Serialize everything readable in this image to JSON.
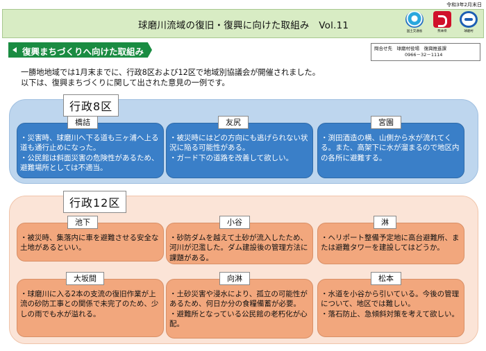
{
  "date": "令和3年2月末日",
  "header": {
    "title": "球磨川流域の復旧・復興に向けた取組み　Vol.11",
    "logos": [
      {
        "icon": "mlit-logo-icon",
        "caption": "国土交通省"
      },
      {
        "icon": "kumamoto-logo-icon",
        "caption": "熊本県"
      },
      {
        "icon": "kuma-village-logo-icon",
        "caption": "球磨村"
      }
    ]
  },
  "section": {
    "banner": "復興まちづくりへ向けた取組み",
    "contact_line1": "問合せ先　球磨村役場　復興推進課",
    "contact_line2": "0966－32－1114"
  },
  "intro": {
    "line1": "一勝地地域では1月末までに、行政8区および12区で地域別協議会が開催されました。",
    "line2": "以下は、復興まちづくりに関して出された意見の一例です。"
  },
  "groups": [
    {
      "label": "行政8区",
      "color": "#3a7fc8",
      "areas": [
        {
          "name": "橋詰",
          "text": "・災害時、球磨川へ下る道も三ヶ浦へ上る道も通行止めになった。\n・公民館は斜面災害の危険性があるため、避難場所としては不適当。"
        },
        {
          "name": "友尻",
          "text": "・被災時にはどの方向にも逃げられない状況に陥る可能性がある。\n・ガード下の道路を改善して欲しい。"
        },
        {
          "name": "宮園",
          "text": "・渕田酒造の横、山側から水が流れてくる。また、高架下に水が溜まるので地区内の各所に避難する。"
        }
      ]
    },
    {
      "label": "行政12区",
      "color": "#f2a77d",
      "areas": [
        {
          "name": "池下",
          "text": "・被災時、集落内に車を避難させる安全な土地があるといい。"
        },
        {
          "name": "小谷",
          "text": "・砂防ダムを越えて土砂が流入したため、河川が氾濫した。ダム建設後の管理方法に課題がある。"
        },
        {
          "name": "淋",
          "text": "・ヘリポート整備予定地に高台避難所、または避難タワーを建設してはどうか。"
        },
        {
          "name": "大坂間",
          "text": "・球磨川に入る2本の支流の復旧作業が上流の砂防工事との関係で未完了のため、少しの雨でも水が溢れる。"
        },
        {
          "name": "向淋",
          "text": "・土砂災害や浸水により、孤立の可能性があるため、何日か分の食糧備蓄が必要。\n・避難所となっている公民館の老朽化が心配。"
        },
        {
          "name": "松本",
          "text": "・水道を小谷から引いている。今後の管理について、地区では難しい。\n・落石防止、急傾斜対策を考えて欲しい。"
        }
      ]
    }
  ]
}
